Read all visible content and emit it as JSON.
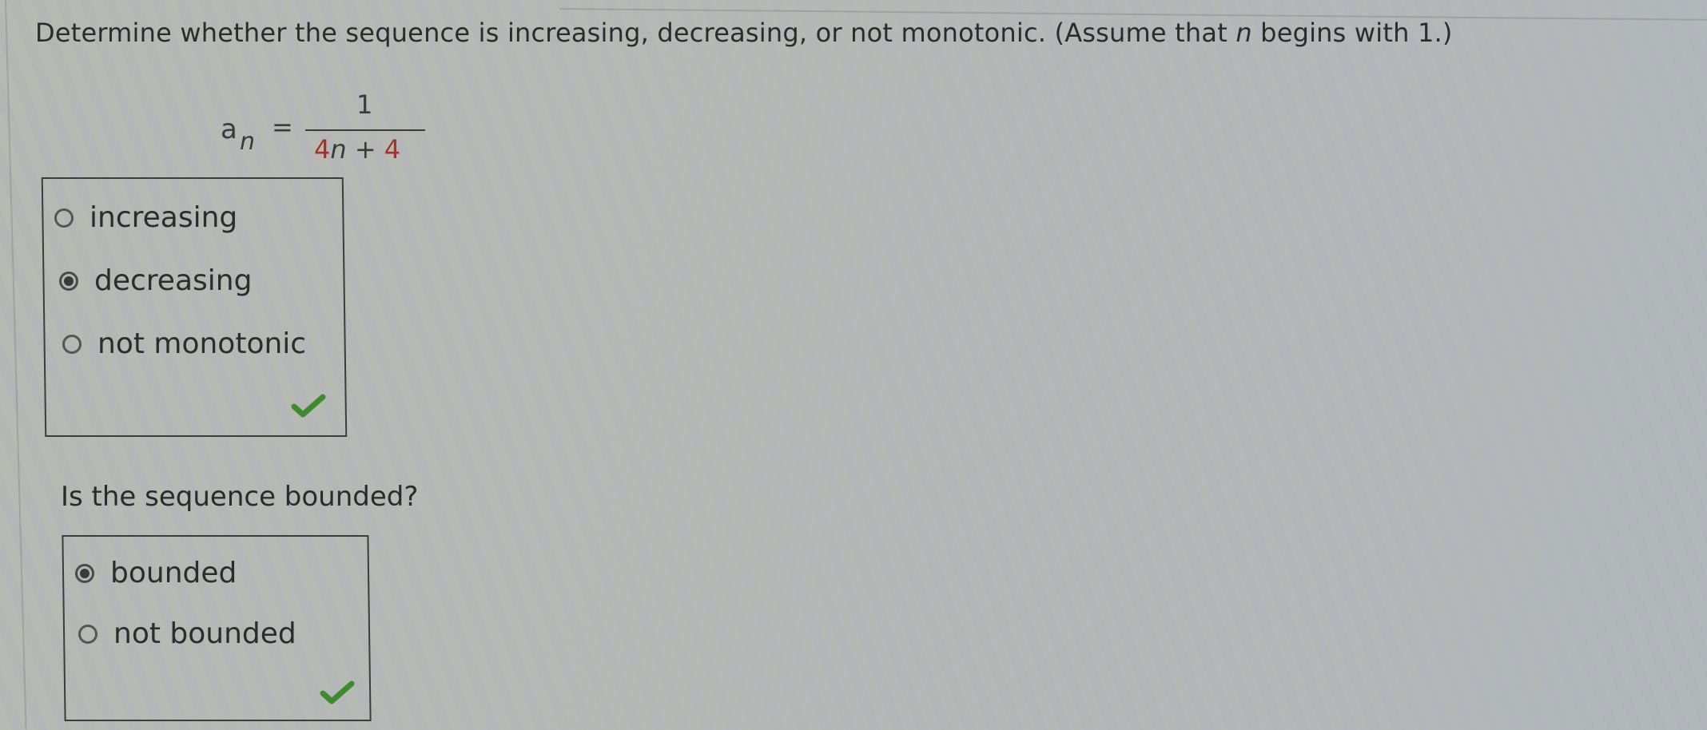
{
  "question": {
    "prefix": "Determine whether the sequence is increasing, decreasing, or not monotonic. (Assume that ",
    "variable": "n",
    "suffix": " begins with 1.)"
  },
  "formula": {
    "lhs_base": "a",
    "lhs_subscript": "n",
    "equals": "=",
    "numerator": "1",
    "denominator": {
      "coef": "4",
      "var": "n",
      "op": " + ",
      "const": "4"
    },
    "highlight_color": "#a8302a"
  },
  "monotonic_group": {
    "options": [
      {
        "label": "increasing",
        "selected": false
      },
      {
        "label": "decreasing",
        "selected": true
      },
      {
        "label": "not monotonic",
        "selected": false
      }
    ],
    "status_icon": "checkmark-icon",
    "status": "correct",
    "status_color": "#3f8a2f"
  },
  "bounded_question": "Is the sequence bounded?",
  "bounded_group": {
    "options": [
      {
        "label": "bounded",
        "selected": true
      },
      {
        "label": "not bounded",
        "selected": false
      }
    ],
    "status_icon": "checkmark-icon",
    "status": "correct",
    "status_color": "#3f8a2f"
  }
}
